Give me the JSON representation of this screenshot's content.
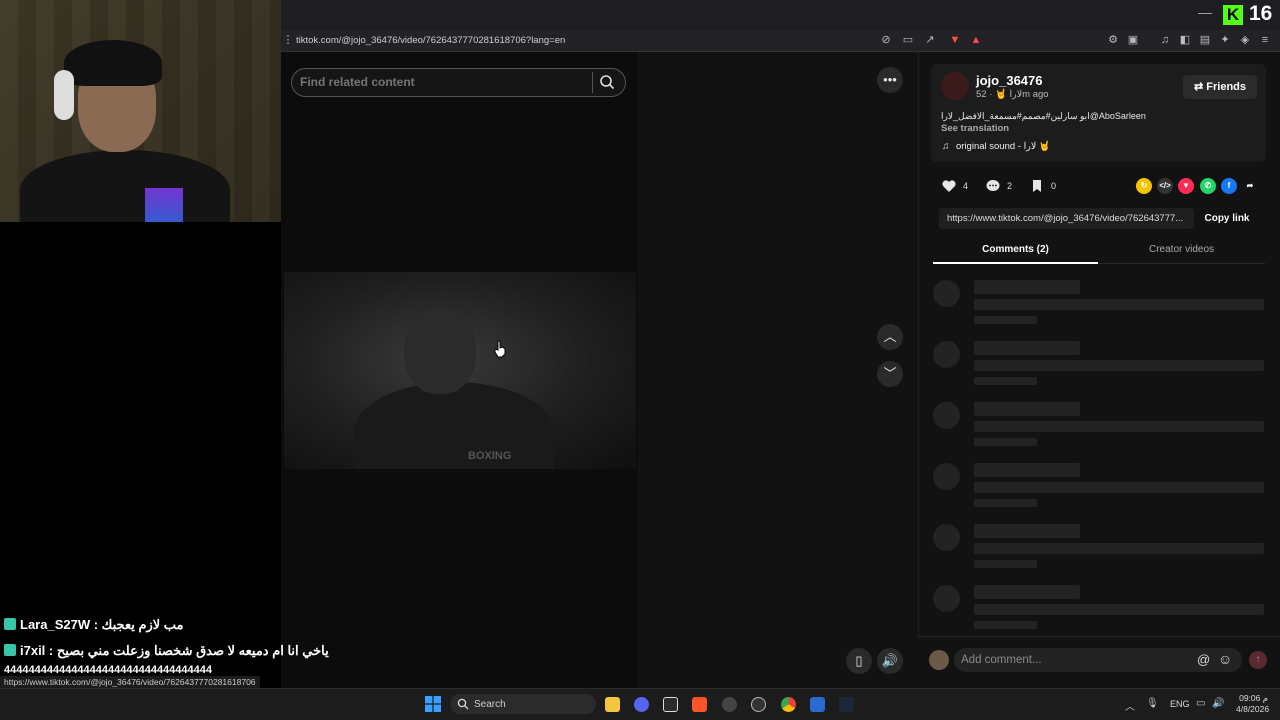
{
  "browser": {
    "url": "tiktok.com/@jojo_36476/video/7626437770281618706?lang=en"
  },
  "kick_widget": {
    "count": "16",
    "logo": "K"
  },
  "search": {
    "placeholder": "Find related content"
  },
  "post": {
    "username": "jojo_36476",
    "subline": "لارا 🤘 · 52m ago",
    "friends_label": "Friends",
    "caption": "ابو سارلين#مصمم#مسمعة_الافضل_لارا@AboSarleen",
    "see_translation": "See translation",
    "sound": "original sound - لارا 🤘",
    "likes": "4",
    "comments": "2",
    "saves": "0",
    "link": "https://www.tiktok.com/@jojo_36476/video/762643777...",
    "copy_link": "Copy link"
  },
  "tabs": {
    "comments": "Comments (2)",
    "creator_videos": "Creator videos"
  },
  "comment_input": {
    "placeholder": "Add comment..."
  },
  "video_overlay_text": "BOXING",
  "chat": [
    {
      "user": "Lara_S27W",
      "message": ": مب لازم يعجبك"
    },
    {
      "user": "i7xil",
      "message": ": ياخي انا ام دميعه لا صدق شخصنا وزعلت مني بصيح"
    },
    {
      "user": "",
      "message": "4444444444444444444444444444444444"
    }
  ],
  "status_url": "https://www.tiktok.com/@jojo_36476/video/7626437770281618706",
  "taskbar": {
    "search_label": "Search",
    "lang": "ENG",
    "time": "09:06 م",
    "date": "4/8/2026"
  },
  "colors": {
    "kick_green": "#53fc18",
    "panel_bg": "#121212",
    "accent_red": "#fe2c55"
  }
}
